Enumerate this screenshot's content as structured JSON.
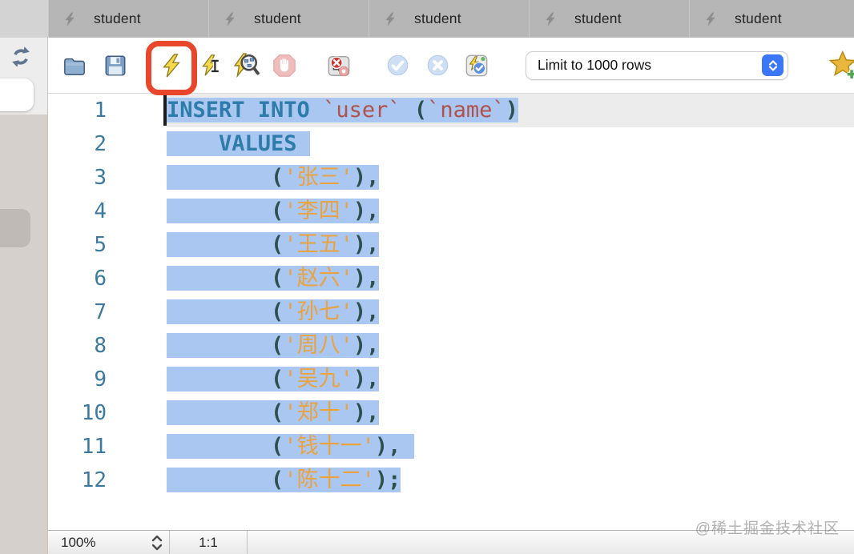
{
  "window": {
    "tabs": [
      {
        "icon": "lightning",
        "label": "student"
      },
      {
        "icon": "lightning",
        "label": "student"
      },
      {
        "icon": "lightning",
        "label": "student"
      },
      {
        "icon": "lightning",
        "label": "student"
      },
      {
        "icon": "lightning",
        "label": "student"
      }
    ]
  },
  "sidebar": {
    "icons": [
      "refresh-icon"
    ]
  },
  "toolbar": {
    "buttons": [
      {
        "name": "open-script",
        "icon": "folder-icon"
      },
      {
        "name": "save-script",
        "icon": "floppy-icon"
      },
      {
        "name": "execute-script",
        "icon": "lightning-icon",
        "highlighted": true
      },
      {
        "name": "execute-current-statement",
        "icon": "lightning-cursor-icon"
      },
      {
        "name": "explain-plan",
        "icon": "lightning-magnifier-icon"
      },
      {
        "name": "stop-execution",
        "icon": "stop-hand-icon",
        "disabled": true
      },
      {
        "name": "toggle-stop-on-error",
        "icon": "stop-on-error-icon"
      },
      {
        "name": "commit",
        "icon": "check-circle-icon",
        "disabled": true
      },
      {
        "name": "rollback",
        "icon": "x-circle-icon",
        "disabled": true
      },
      {
        "name": "toggle-autocommit",
        "icon": "lightning-check-icon"
      }
    ],
    "limit_select": {
      "value": "Limit to 1000 rows",
      "stepper_icon": "up-down-chevrons-icon"
    },
    "favorite": {
      "icon": "star-plus-icon"
    }
  },
  "editor": {
    "lines": [
      {
        "num": "1",
        "active": true,
        "selected": true,
        "segments": [
          [
            "kw",
            "INSERT INTO"
          ],
          [
            "pl",
            " "
          ],
          [
            "id",
            "`user`"
          ],
          [
            "pl",
            " "
          ],
          [
            "pa",
            "("
          ],
          [
            "id",
            "`name`"
          ],
          [
            "pa",
            ")"
          ]
        ]
      },
      {
        "num": "2",
        "selected": true,
        "segments": [
          [
            "pl",
            "    "
          ],
          [
            "kw",
            "VALUES"
          ],
          [
            "pl",
            " "
          ]
        ]
      },
      {
        "num": "3",
        "selected": true,
        "segments": [
          [
            "pl",
            "        "
          ],
          [
            "pa",
            "("
          ],
          [
            "st",
            "'张三'"
          ],
          [
            "pa",
            "),"
          ]
        ]
      },
      {
        "num": "4",
        "selected": true,
        "segments": [
          [
            "pl",
            "        "
          ],
          [
            "pa",
            "("
          ],
          [
            "st",
            "'李四'"
          ],
          [
            "pa",
            "),"
          ]
        ]
      },
      {
        "num": "5",
        "selected": true,
        "segments": [
          [
            "pl",
            "        "
          ],
          [
            "pa",
            "("
          ],
          [
            "st",
            "'王五'"
          ],
          [
            "pa",
            "),"
          ]
        ]
      },
      {
        "num": "6",
        "selected": true,
        "segments": [
          [
            "pl",
            "        "
          ],
          [
            "pa",
            "("
          ],
          [
            "st",
            "'赵六'"
          ],
          [
            "pa",
            "),"
          ]
        ]
      },
      {
        "num": "7",
        "selected": true,
        "segments": [
          [
            "pl",
            "        "
          ],
          [
            "pa",
            "("
          ],
          [
            "st",
            "'孙七'"
          ],
          [
            "pa",
            "),"
          ]
        ]
      },
      {
        "num": "8",
        "selected": true,
        "segments": [
          [
            "pl",
            "        "
          ],
          [
            "pa",
            "("
          ],
          [
            "st",
            "'周八'"
          ],
          [
            "pa",
            "),"
          ]
        ]
      },
      {
        "num": "9",
        "selected": true,
        "segments": [
          [
            "pl",
            "        "
          ],
          [
            "pa",
            "("
          ],
          [
            "st",
            "'吴九'"
          ],
          [
            "pa",
            "),"
          ]
        ]
      },
      {
        "num": "10",
        "selected": true,
        "segments": [
          [
            "pl",
            "        "
          ],
          [
            "pa",
            "("
          ],
          [
            "st",
            "'郑十'"
          ],
          [
            "pa",
            "),"
          ]
        ]
      },
      {
        "num": "11",
        "selected": true,
        "segments": [
          [
            "pl",
            "        "
          ],
          [
            "pa",
            "("
          ],
          [
            "st",
            "'钱十一'"
          ],
          [
            "pa",
            "),"
          ],
          [
            "pl",
            " "
          ]
        ]
      },
      {
        "num": "12",
        "selected": true,
        "segments": [
          [
            "pl",
            "        "
          ],
          [
            "pa",
            "("
          ],
          [
            "st",
            "'陈十二'"
          ],
          [
            "pa",
            ");"
          ]
        ]
      }
    ]
  },
  "status_bar": {
    "zoom_level": "100%",
    "zoom_stepper_icon": "up-down-chevrons-icon",
    "caret_position": "1:1"
  },
  "watermark": "@稀土掘金技术社区",
  "colors": {
    "selection": "#a9c7f1",
    "keyword": "#2e7ca9",
    "identifier": "#b0514c",
    "paren": "#2f4f4f",
    "string": "#eaa33e",
    "line_number": "#3b7a9e",
    "active_line": "#ececec",
    "accent_red": "#e8472b"
  }
}
